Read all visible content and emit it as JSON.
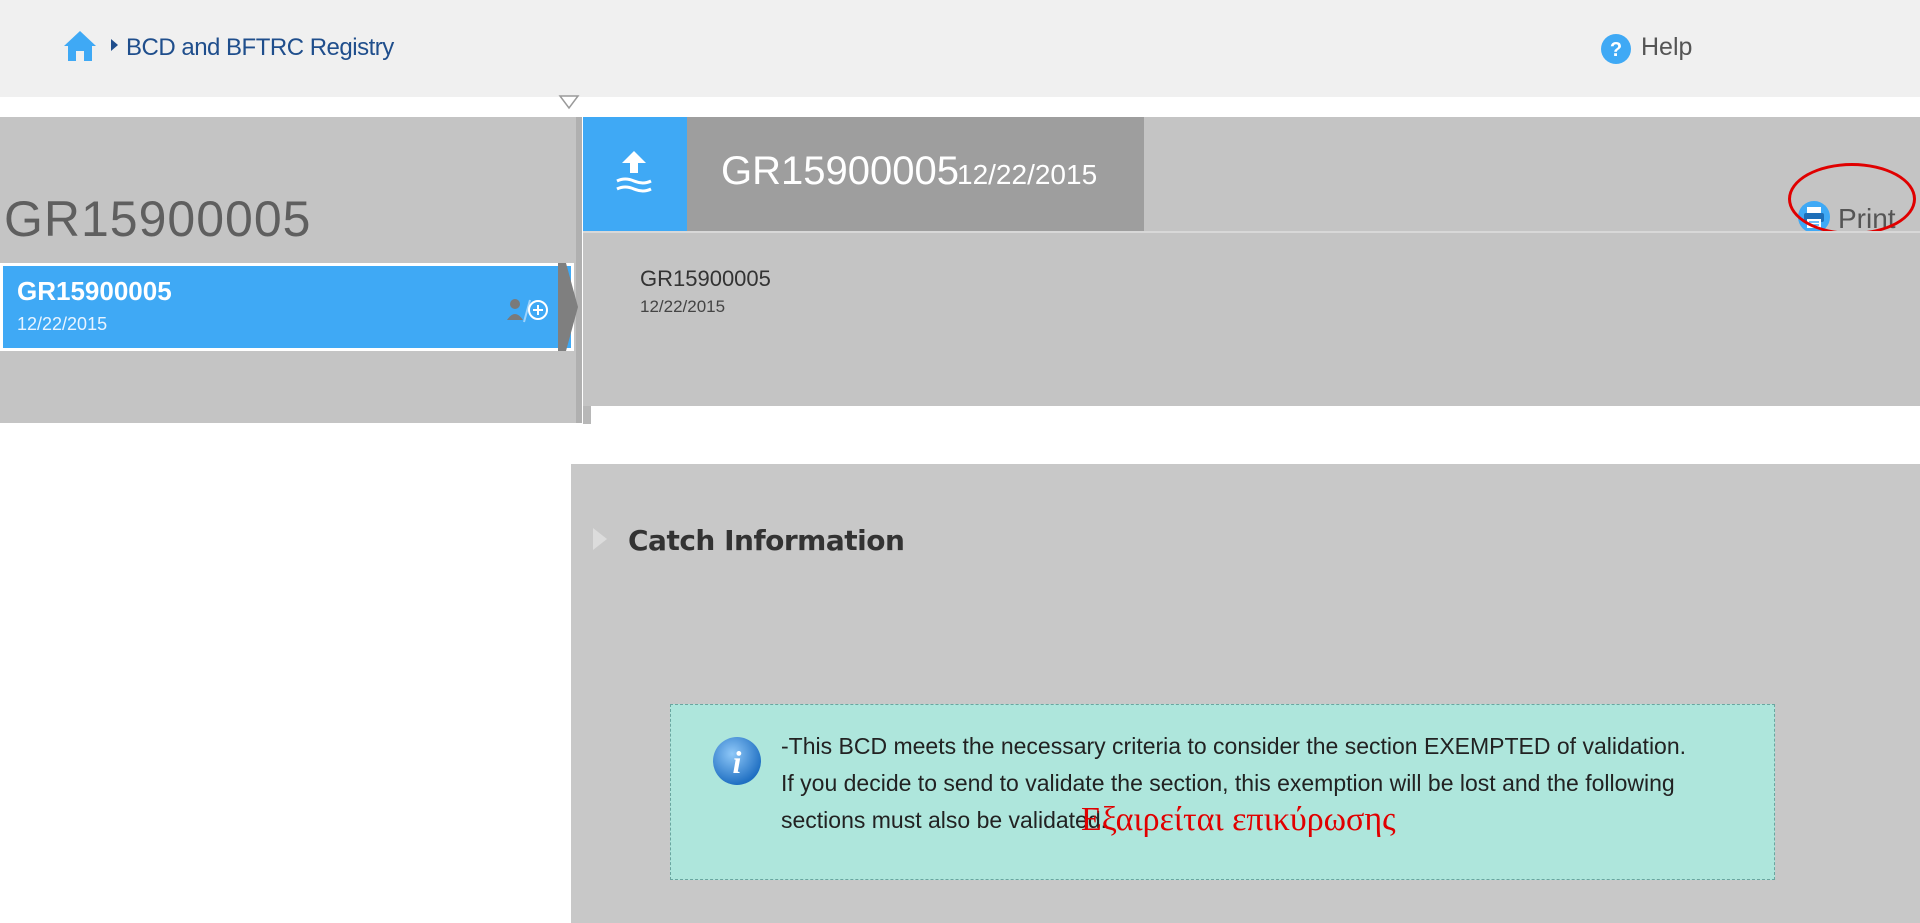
{
  "breadcrumb": {
    "home_icon": "home-icon",
    "separator_icon": "caret-right-icon",
    "section": "BCD and BFTRC Registry"
  },
  "help": {
    "icon": "help-icon",
    "label": "Help"
  },
  "sidebar": {
    "title": "GR15900005",
    "items": [
      {
        "id": "GR15900005",
        "date": "12/22/2015",
        "icon": "user-add-icon"
      }
    ]
  },
  "record_header": {
    "upload_icon": "upload-icon",
    "id": "GR15900005",
    "date": "12/22/2015",
    "print_label": "Print",
    "print_icon": "printer-icon",
    "annotation_color": "#e00000"
  },
  "record_details": {
    "id": "GR15900005",
    "date": "12/22/2015"
  },
  "catch_section": {
    "title": "Catch Information",
    "expand_icon": "triangle-right-icon"
  },
  "info_message": {
    "icon": "info-icon",
    "line1": "-This BCD meets the necessary criteria to consider the section EXEMPTED of validation.",
    "line2": "If you decide to send to validate the section, this exemption will be lost and the following",
    "line3": "sections must also be validated.",
    "greek_note": "Εξαιρείται επικύρωσης"
  },
  "colors": {
    "accent_blue": "#3fa9f5",
    "panel_gray": "#c4c4c4",
    "info_bg": "#aee6dc",
    "annotation_red": "#e00000"
  }
}
